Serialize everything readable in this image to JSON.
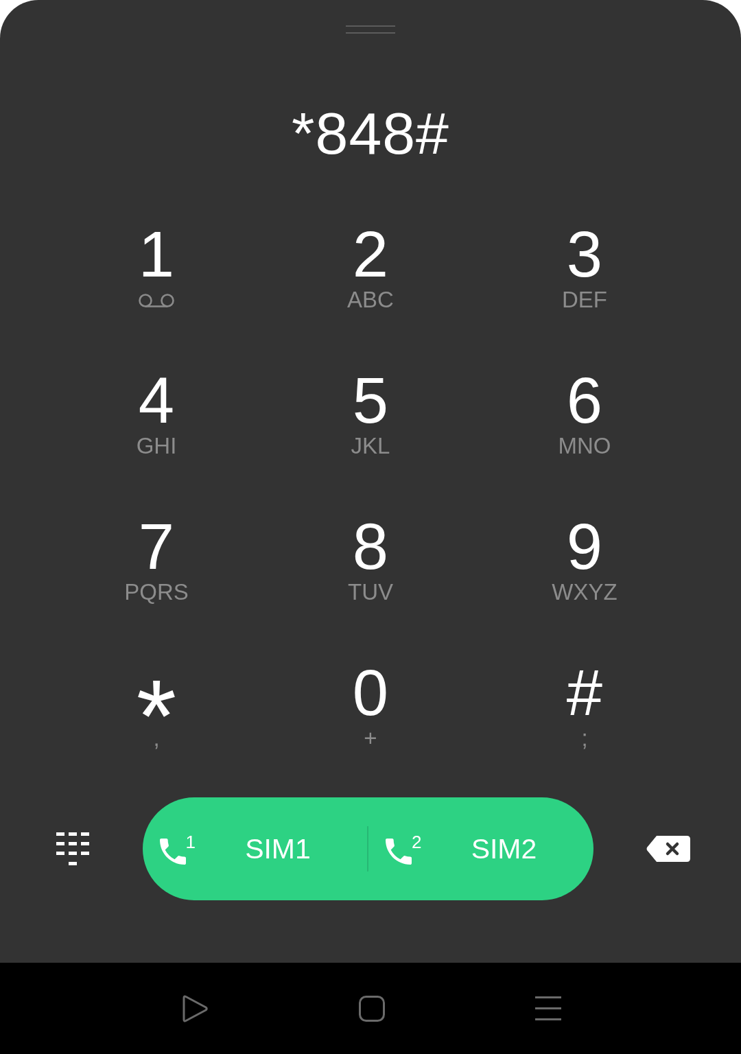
{
  "display": {
    "number": "*848#"
  },
  "keypad": [
    {
      "digit": "1",
      "kind": "voicemail"
    },
    {
      "digit": "2",
      "kind": "letters",
      "letters": "ABC"
    },
    {
      "digit": "3",
      "kind": "letters",
      "letters": "DEF"
    },
    {
      "digit": "4",
      "kind": "letters",
      "letters": "GHI"
    },
    {
      "digit": "5",
      "kind": "letters",
      "letters": "JKL"
    },
    {
      "digit": "6",
      "kind": "letters",
      "letters": "MNO"
    },
    {
      "digit": "7",
      "kind": "letters",
      "letters": "PQRS"
    },
    {
      "digit": "8",
      "kind": "letters",
      "letters": "TUV"
    },
    {
      "digit": "9",
      "kind": "letters",
      "letters": "WXYZ"
    },
    {
      "digit": "*",
      "kind": "star",
      "letters": ","
    },
    {
      "digit": "0",
      "kind": "letters",
      "letters": "+"
    },
    {
      "digit": "#",
      "kind": "letters",
      "letters": ";"
    }
  ],
  "call_bar": {
    "sims": [
      {
        "number": "1",
        "label": "SIM1"
      },
      {
        "number": "2",
        "label": "SIM2"
      }
    ]
  }
}
